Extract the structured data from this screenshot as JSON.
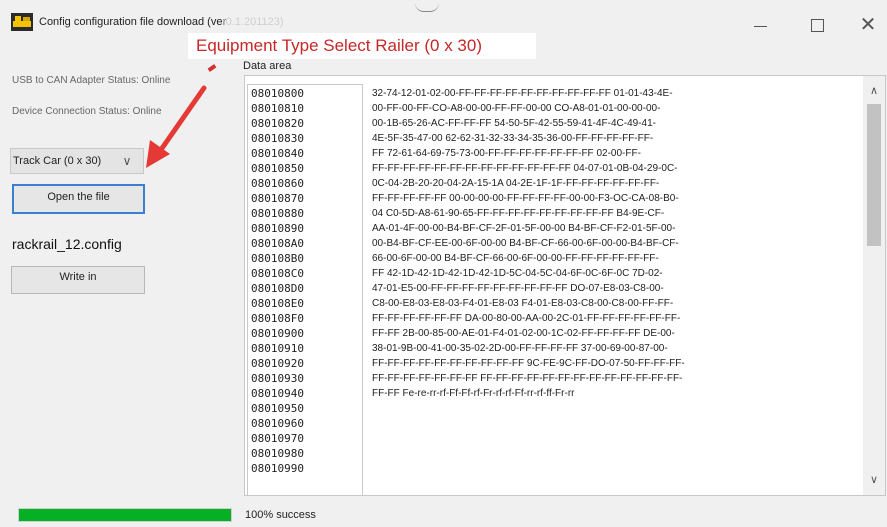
{
  "window": {
    "title": "Config configuration file download (ver",
    "title_faded": "r0.1.201123)",
    "minimize_label": "—",
    "maximize_label": "",
    "close_label": "✕"
  },
  "annotation": {
    "text": "Equipment Type Select Railer (0 x 30)",
    "color": "#c62828"
  },
  "status": {
    "usb": "USB to CAN Adapter Status: Online",
    "device": "Device Connection Status: Online"
  },
  "controls": {
    "equipment_select_value": "Track Car (0 x 30)",
    "open_file_label": "Open the file",
    "filename": "rackrail_12.config",
    "write_label": "Write in"
  },
  "data_area": {
    "label": "Data area",
    "addresses": [
      "08010800",
      "08010810",
      "08010820",
      "08010830",
      "08010840",
      "08010850",
      "08010860",
      "08010870",
      "08010880",
      "08010890",
      "080108A0",
      "080108B0",
      "080108C0",
      "080108D0",
      "080108E0",
      "080108F0",
      "08010900",
      "08010910",
      "08010920",
      "08010930",
      "08010940",
      "08010950",
      "08010960",
      "08010970",
      "08010980",
      "08010990"
    ],
    "hex_lines": [
      "32-74-12-01-02-00-FF-FF-FF-FF-FF-FF-FF-FF-FF-FF 01-01-43-4E-",
      "00-FF-00-FF-CO-A8-00-00-FF-FF-00-00 CO-A8-01-01-00-00-00-",
      "00-1B-65-26-AC-FF-FF-FF 54-50-5F-42-55-59-41-4F-4C-49-41-",
      "4E-5F-35-47-00 62-62-31-32-33-34-35-36-00-FF-FF-FF-FF-FF-",
      "FF 72-61-64-69-75-73-00-FF-FF-FF-FF-FF-FF-FF 02-00-FF-",
      "FF-FF-FF-FF-FF-FF-FF-FF-FF-FF-FF-FF-FF 04-07-01-0B-04-29-0C-",
      "0C-04-2B-20-20-04-2A-15-1A 04-2E-1F-1F-FF-FF-FF-FF-FF-FF-",
      "FF-FF-FF-FF-FF 00-00-00-00-FF-FF-FF-FF-00-00-F3-OC-CA-08-B0-",
      "04 C0-5D-A8-61-90-65-FF-FF-FF-FF-FF-FF-FF-FF-FF B4-9E-CF-",
      "AA-01-4F-00-00-B4-BF-CF-2F-01-5F-00-00 B4-BF-CF-F2-01-5F-00-",
      "00-B4-BF-CF-EE-00-6F-00-00 B4-BF-CF-66-00-6F-00-00-B4-BF-CF-",
      "66-00-6F-00-00 B4-BF-CF-66-00-6F-00-00-FF-FF-FF-FF-FF-FF-",
      "FF 42-1D-42-1D-42-1D-42-1D-5C-04-5C-04-6F-0C-6F-0C 7D-02-",
      "47-01-E5-00-FF-FF-FF-FF-FF-FF-FF-FF-FF DO-07-E8-03-C8-00-",
      "C8-00-E8-03-E8-03-F4-01-E8-03 F4-01-E8-03-C8-00-C8-00-FF-FF-",
      "FF-FF-FF-FF-FF-FF DA-00-80-00-AA-00-2C-01-FF-FF-FF-FF-FF-FF-",
      "FF-FF 2B-00-85-00-AE-01-F4-01-02-00-1C-02-FF-FF-FF-FF DE-00-",
      "38-01-9B-00-41-00-35-02-2D-00-FF-FF-FF-FF 37-00-69-00-87-00-",
      "FF-FF-FF-FF-FF-FF-FF-FF-FF-FF 9C-FE-9C-FF-DO-07-50-FF-FF-FF-",
      "FF-FF-FF-FF-FF-FF-FF FF-FF-FF-FF-FF-FF-FF-FF-FF-FF-FF-FF-FF-",
      "FF-FF Fe-re-rr-rf-Ff-Ff-rf-Fr-rf-rf-Ff-rr-rf-ff-Fr-rr"
    ]
  },
  "footer": {
    "progress_fraction": 1.0,
    "progress_color": "#06b025",
    "status_text": "100% success"
  }
}
